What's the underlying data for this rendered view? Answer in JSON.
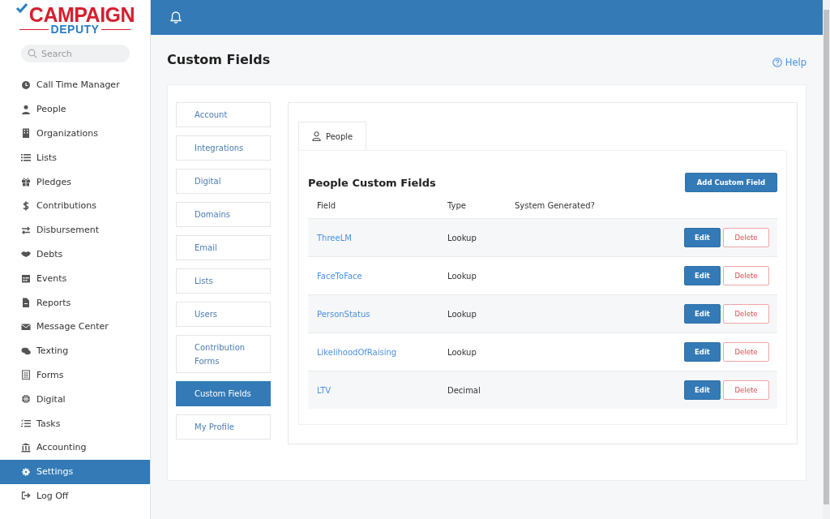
{
  "logo": {
    "top": "CAMPAIGN",
    "bottom": "DEPUTY"
  },
  "search": {
    "placeholder": "Search"
  },
  "sidebar": {
    "items": [
      {
        "label": "Call Time Manager",
        "selected": false
      },
      {
        "label": "People",
        "selected": false
      },
      {
        "label": "Organizations",
        "selected": false
      },
      {
        "label": "Lists",
        "selected": false
      },
      {
        "label": "Pledges",
        "selected": false
      },
      {
        "label": "Contributions",
        "selected": false
      },
      {
        "label": "Disbursement",
        "selected": false
      },
      {
        "label": "Debts",
        "selected": false
      },
      {
        "label": "Events",
        "selected": false
      },
      {
        "label": "Reports",
        "selected": false
      },
      {
        "label": "Message Center",
        "selected": false
      },
      {
        "label": "Texting",
        "selected": false
      },
      {
        "label": "Forms",
        "selected": false
      },
      {
        "label": "Digital",
        "selected": false
      },
      {
        "label": "Tasks",
        "selected": false
      },
      {
        "label": "Accounting",
        "selected": false
      },
      {
        "label": "Settings",
        "selected": true
      },
      {
        "label": "Log Off",
        "selected": false
      }
    ]
  },
  "page": {
    "title": "Custom Fields",
    "help": "Help"
  },
  "settings_nav": [
    {
      "label": "Account",
      "selected": false
    },
    {
      "label": "Integrations",
      "selected": false
    },
    {
      "label": "Digital",
      "selected": false
    },
    {
      "label": "Domains",
      "selected": false
    },
    {
      "label": "Email",
      "selected": false
    },
    {
      "label": "Lists",
      "selected": false
    },
    {
      "label": "Users",
      "selected": false
    },
    {
      "label": "Contribution Forms",
      "selected": false
    },
    {
      "label": "Custom Fields",
      "selected": true
    },
    {
      "label": "My Profile",
      "selected": false
    }
  ],
  "tabs": [
    {
      "label": "People",
      "selected": true
    }
  ],
  "section": {
    "title": "People Custom Fields",
    "add_button": "Add Custom Field"
  },
  "table": {
    "columns": [
      "Field",
      "Type",
      "System Generated?"
    ],
    "rows": [
      {
        "field": "ThreeLM",
        "type": "Lookup",
        "edit": "Edit",
        "delete": "Delete"
      },
      {
        "field": "FaceToFace",
        "type": "Lookup",
        "edit": "Edit",
        "delete": "Delete"
      },
      {
        "field": "PersonStatus",
        "type": "Lookup",
        "edit": "Edit",
        "delete": "Delete"
      },
      {
        "field": "LikelihoodOfRaising",
        "type": "Lookup",
        "edit": "Edit",
        "delete": "Delete"
      },
      {
        "field": "LTV",
        "type": "Decimal",
        "edit": "Edit",
        "delete": "Delete"
      }
    ]
  }
}
